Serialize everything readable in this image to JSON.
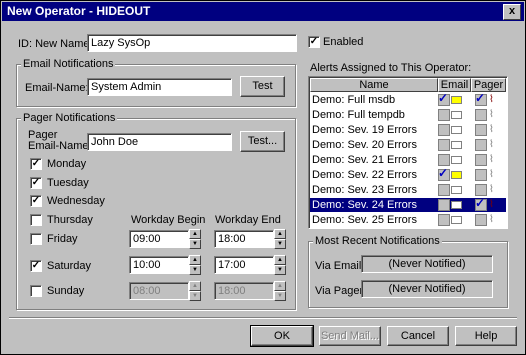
{
  "window": {
    "title": "New Operator - HIDEOUT",
    "close_glyph": "x"
  },
  "general": {
    "id_name_label": "ID: New  Name:",
    "name_value": "Lazy SysOp",
    "enabled_label": "Enabled",
    "enabled_checked": true
  },
  "email": {
    "group_title": "Email Notifications",
    "name_label": "Email-Name:",
    "name_value": "System Admin",
    "test_label": "Test"
  },
  "pager": {
    "group_title": "Pager Notifications",
    "name_label_1": "Pager",
    "name_label_2": "Email-Name:",
    "name_value": "John Doe",
    "test_label": "Test...",
    "workday_begin_label": "Workday Begin",
    "workday_end_label": "Workday End",
    "days": [
      {
        "label": "Monday",
        "checked": true
      },
      {
        "label": "Tuesday",
        "checked": true
      },
      {
        "label": "Wednesday",
        "checked": true
      },
      {
        "label": "Thursday",
        "checked": false
      },
      {
        "label": "Friday",
        "checked": false,
        "begin": "09:00",
        "end": "18:00"
      },
      {
        "label": "Saturday",
        "checked": true,
        "begin": "10:00",
        "end": "17:00"
      },
      {
        "label": "Sunday",
        "checked": false,
        "begin": "08:00",
        "end": "18:00"
      }
    ]
  },
  "alerts": {
    "title": "Alerts Assigned to This Operator:",
    "columns": [
      "Name",
      "Email",
      "Pager"
    ],
    "rows": [
      {
        "name": "Demo: Full msdb",
        "email": true,
        "pager": true
      },
      {
        "name": "Demo: Full tempdb",
        "email": false,
        "pager": false
      },
      {
        "name": "Demo: Sev. 19 Errors",
        "email": false,
        "pager": false
      },
      {
        "name": "Demo: Sev. 20 Errors",
        "email": false,
        "pager": false
      },
      {
        "name": "Demo: Sev. 21 Errors",
        "email": false,
        "pager": false
      },
      {
        "name": "Demo: Sev. 22 Errors",
        "email": true,
        "pager": false
      },
      {
        "name": "Demo: Sev. 23 Errors",
        "email": false,
        "pager": false
      },
      {
        "name": "Demo: Sev. 24 Errors",
        "email": false,
        "pager": true,
        "selected": true
      },
      {
        "name": "Demo: Sev. 25 Errors",
        "email": false,
        "pager": false
      }
    ]
  },
  "recent": {
    "group_title": "Most Recent Notifications",
    "via_email_label": "Via Email:",
    "via_email_value": "(Never Notified)",
    "via_pager_label": "Via Pager:",
    "via_pager_value": "(Never Notified)"
  },
  "buttons": {
    "ok": "OK",
    "send_mail": "Send Mail...",
    "cancel": "Cancel",
    "help": "Help"
  },
  "colors": {
    "title_bar": "#000080",
    "face": "#c0c0c0",
    "selection": "#000080"
  }
}
